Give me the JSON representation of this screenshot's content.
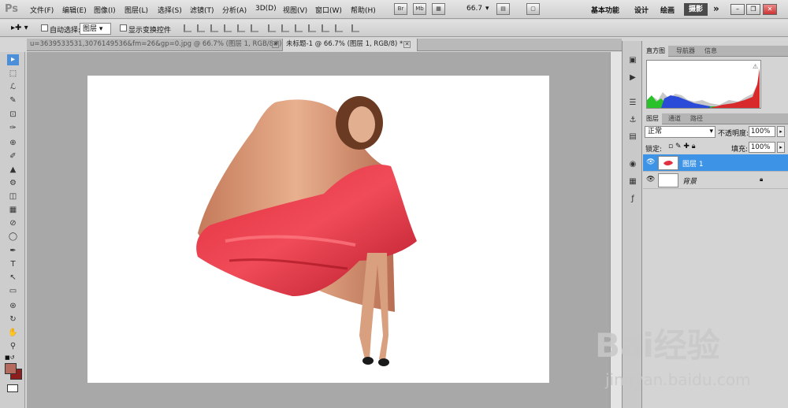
{
  "app": {
    "logo": "Ps"
  },
  "menu": [
    "文件(F)",
    "编辑(E)",
    "图像(I)",
    "图层(L)",
    "选择(S)",
    "滤镜(T)",
    "分析(A)",
    "3D(D)",
    "视图(V)",
    "窗口(W)",
    "帮助(H)"
  ],
  "menubar_buttons": {
    "br": "Br",
    "mb": "Mb",
    "zoom": "66.7"
  },
  "workspaces": [
    "基本功能",
    "设计",
    "绘画"
  ],
  "workspace_active": "摄影",
  "workspace_more": "»",
  "window_controls": [
    "–",
    "❐",
    "✕"
  ],
  "options": {
    "auto_select_label": "自动选择:",
    "auto_select_value": "图层",
    "show_transform_label": "显示变换控件"
  },
  "tabs": [
    {
      "label": "u=3639533531,3076149536&fm=26&gp=0.jpg @ 66.7% (图层 1, RGB/8#) *",
      "close": "✕"
    },
    {
      "label": "未标题-1 @ 66.7% (图层 1, RGB/8) *",
      "close": "✕"
    }
  ],
  "tools": [
    "▸",
    "⬚",
    "ℒ",
    "✎",
    "⊡",
    "✑",
    "⊕",
    "✐",
    "▲",
    "⚙",
    "◫",
    "▦",
    "⊘",
    "◯",
    "✒",
    "T",
    "↖",
    "▭",
    "⊛",
    "↻",
    "✋",
    "⚲"
  ],
  "colors": {
    "foreground": "#b56a5e",
    "background": "#8e1e1e",
    "accent": "#3d93e6"
  },
  "panels": {
    "top_tabs": [
      "直方图",
      "导航器",
      "信息"
    ],
    "layer_tabs": [
      "图层",
      "通道",
      "路径"
    ],
    "blend_mode": "正常",
    "opacity_label": "不透明度:",
    "opacity_value": "100%",
    "lock_label": "锁定:",
    "fill_label": "填充:",
    "fill_value": "100%",
    "layers": [
      {
        "name": "图层 1",
        "selected": true
      },
      {
        "name": "背景",
        "selected": false
      }
    ]
  },
  "watermark": {
    "main": "Bai经验",
    "sub": "jingyan.baidu.com"
  }
}
